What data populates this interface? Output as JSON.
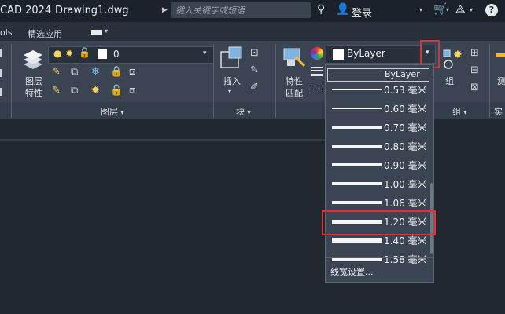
{
  "titlebar": {
    "app": "CAD 2024",
    "file": "Drawing1.dwg",
    "search_placeholder": "键入关键字或短语",
    "login": "登录"
  },
  "tabrow": {
    "tools_partial": "ols",
    "featured": "精选应用"
  },
  "ribbon": {
    "layers_button": [
      "图层",
      "特性"
    ],
    "layer_current": "0",
    "layers_panel_title": "图层",
    "insert_button": "插入",
    "block_panel_title": "块",
    "match_props": [
      "特性",
      "匹配"
    ],
    "color_value": "ByLayer",
    "group_button": "组",
    "group_panel_title": "组",
    "partial_right": "测",
    "partial_right2": "实"
  },
  "lineweight_dropdown": {
    "header": "ByLayer",
    "items": [
      {
        "label": "0.53 毫米",
        "mm": 0.53
      },
      {
        "label": "0.60 毫米",
        "mm": 0.6
      },
      {
        "label": "0.70 毫米",
        "mm": 0.7
      },
      {
        "label": "0.80 毫米",
        "mm": 0.8
      },
      {
        "label": "0.90 毫米",
        "mm": 0.9
      },
      {
        "label": "1.00 毫米",
        "mm": 1.0
      },
      {
        "label": "1.06 毫米",
        "mm": 1.06
      },
      {
        "label": "1.20 毫米",
        "mm": 1.2
      },
      {
        "label": "1.40 毫米",
        "mm": 1.4
      },
      {
        "label": "1.58 毫米",
        "mm": 1.58
      }
    ],
    "highlighted": "1.20 毫米",
    "footer": "线宽设置..."
  },
  "colors": {
    "highlight_red": "#e03234"
  }
}
